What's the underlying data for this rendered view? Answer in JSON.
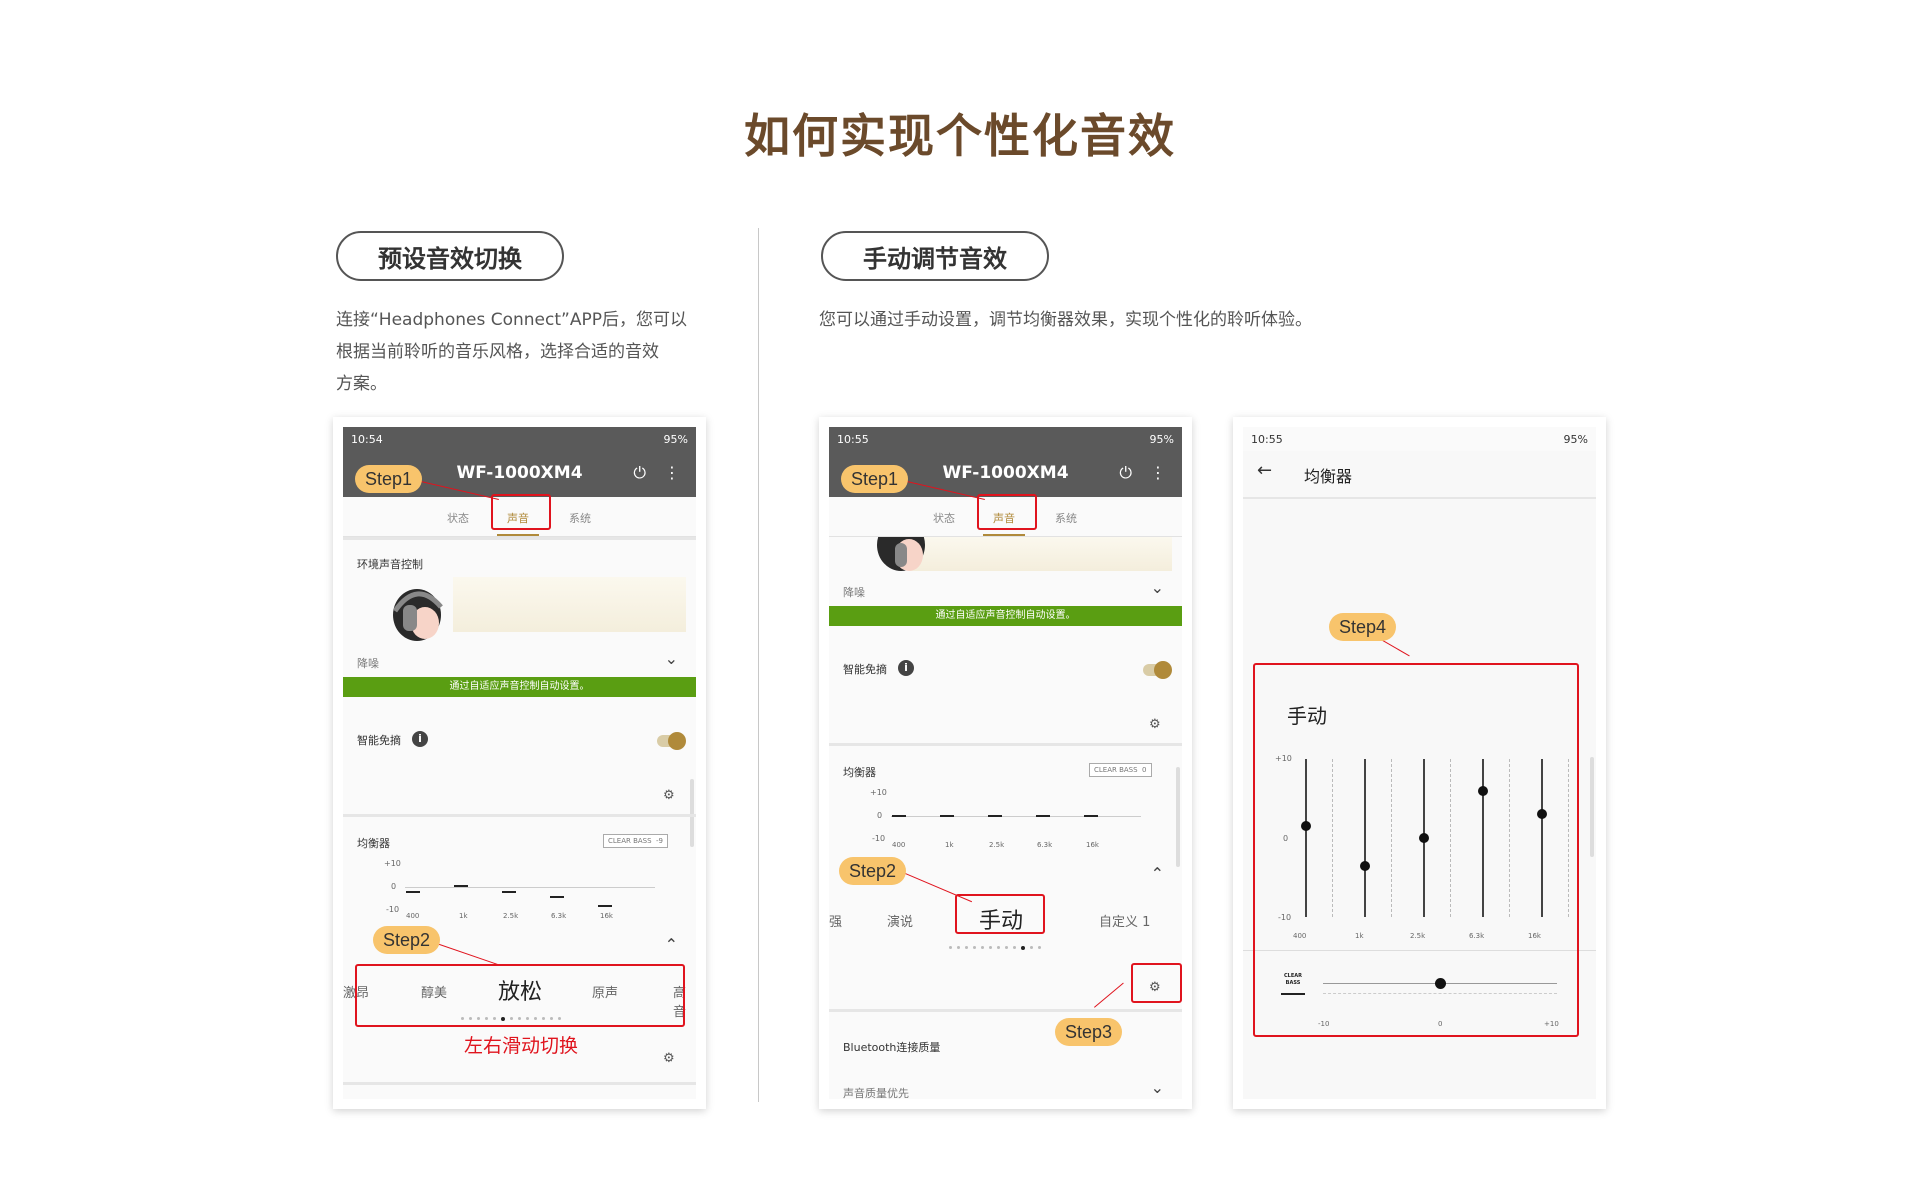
{
  "page": {
    "title": "如何实现个性化音效"
  },
  "left_section": {
    "pill": "预设音效切换",
    "desc_lines": [
      "连接“Headphones Connect”APP后，您可以",
      "根据当前聆听的音乐风格，选择合适的音效",
      "方案。"
    ]
  },
  "right_section": {
    "pill": "手动调节音效",
    "desc": "您可以通过手动设置，调节均衡器效果，实现个性化的聆听体验。"
  },
  "phone1": {
    "time": "10:54",
    "battery": "95%",
    "device": "WF-1000XM4",
    "tabs": [
      "状态",
      "声音",
      "系统"
    ],
    "ambient_label": "环境声音控制",
    "noise_label": "降噪",
    "adaptive_banner": "通过自适应声音控制自动设置。",
    "speak_to_chat": "智能免摘",
    "equalizer": "均衡器",
    "clear_bass": "CLEAR BASS",
    "clear_bass_val": "-9",
    "y_labels": [
      "+10",
      "0",
      "-10"
    ],
    "x_labels": [
      "400",
      "1k",
      "2.5k",
      "6.3k",
      "16k"
    ],
    "presets": [
      "激昂",
      "醇美",
      "放松",
      "原声",
      "高音"
    ],
    "step1": "Step1",
    "step2": "Step2",
    "swipe_caption": "左右滑动切换"
  },
  "phone2": {
    "time": "10:55",
    "battery": "95%",
    "device": "WF-1000XM4",
    "tabs": [
      "状态",
      "声音",
      "系统"
    ],
    "noise_label": "降噪",
    "adaptive_banner": "通过自适应声音控制自动设置。",
    "speak_to_chat": "智能免摘",
    "equalizer": "均衡器",
    "clear_bass": "CLEAR BASS",
    "clear_bass_val": "0",
    "y_labels": [
      "+10",
      "0",
      "-10"
    ],
    "x_labels": [
      "400",
      "1k",
      "2.5k",
      "6.3k",
      "16k"
    ],
    "presets": [
      "强",
      "演说",
      "手动",
      "自定义 1"
    ],
    "bluetooth_quality": "Bluetooth连接质量",
    "sound_priority": "声音质量优先",
    "step1": "Step1",
    "step2": "Step2",
    "step3": "Step3"
  },
  "phone3": {
    "time": "10:55",
    "battery": "95%",
    "screen_title": "均衡器",
    "manual": "手动",
    "y_labels": [
      "+10",
      "0",
      "-10"
    ],
    "x_labels": [
      "400",
      "1k",
      "2.5k",
      "6.3k",
      "16k"
    ],
    "clear_bass_icon_text": "CLEAR BASS",
    "slider_labels": [
      "-10",
      "0",
      "+10"
    ],
    "step4": "Step4",
    "eq_values": [
      1.5,
      -3.5,
      0,
      6,
      3
    ],
    "clear_bass_value": 0
  }
}
